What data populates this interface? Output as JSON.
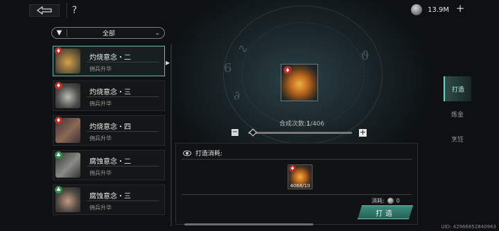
{
  "topbar": {
    "help_label": "?",
    "currency_value": "13.9M",
    "plus_label": "+"
  },
  "filter": {
    "label": "全部"
  },
  "list": {
    "items": [
      {
        "name": "灼烧意念・二",
        "sub": "佣兵升华",
        "badge_color": "#b62e25",
        "thumb": "#6b5a3a"
      },
      {
        "name": "灼烧意念・三",
        "sub": "佣兵升华",
        "badge_color": "#b62e25",
        "thumb": "#4a4a48"
      },
      {
        "name": "灼烧意念・四",
        "sub": "佣兵升华",
        "badge_color": "#b62e25",
        "thumb": "#4d3d4a"
      },
      {
        "name": "腐蚀意念・二",
        "sub": "佣兵升华",
        "badge_color": "#2f8a4a",
        "thumb": "#3b4a3a"
      },
      {
        "name": "腐蚀意念・三",
        "sub": "佣兵升华",
        "badge_color": "#2f8a4a",
        "thumb": "#4a4540"
      }
    ]
  },
  "craft": {
    "count_label": "合成次数:",
    "count_current": "1",
    "count_total": "/406",
    "level": 0.02
  },
  "cost": {
    "title": "打造消耗:",
    "material_count": "4068/10",
    "consume_label": "消耗:",
    "consume_value": "0",
    "button_label": "打造"
  },
  "tabs": [
    {
      "label": "打造",
      "active": true
    },
    {
      "label": "炼金",
      "active": false
    },
    {
      "label": "烹饪",
      "active": false
    }
  ],
  "uid": "UID: 42966852840963"
}
